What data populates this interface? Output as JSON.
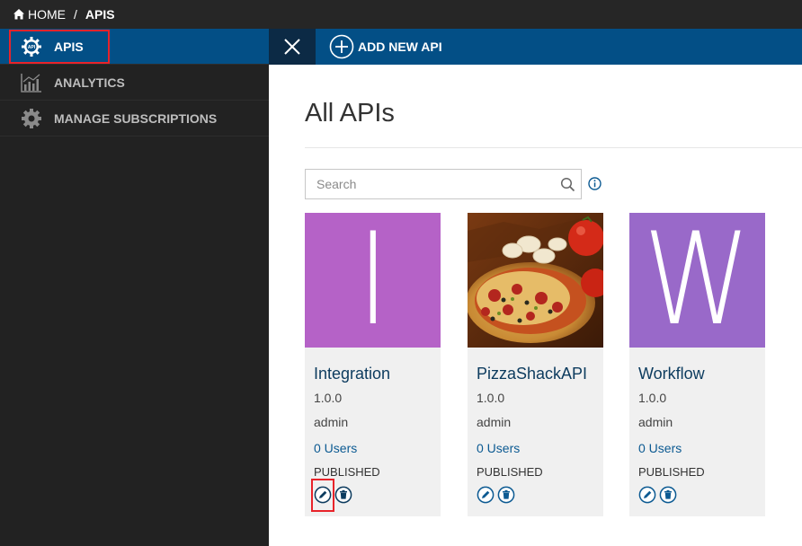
{
  "breadcrumb": {
    "home_label": "HOME",
    "separator": "/",
    "current": "APIS"
  },
  "sidebar": {
    "items": [
      {
        "label": "APIS",
        "icon": "api-gear-icon",
        "active": true
      },
      {
        "label": "ANALYTICS",
        "icon": "analytics-chart-icon",
        "active": false
      },
      {
        "label": "MANAGE SUBSCRIPTIONS",
        "icon": "gear-icon",
        "active": false
      }
    ]
  },
  "actionbar": {
    "add_label": "ADD NEW API"
  },
  "main": {
    "title": "All APIs",
    "search": {
      "placeholder": "Search",
      "value": ""
    }
  },
  "cards": [
    {
      "thumb_letter": "I",
      "thumb_color": "#b562c7",
      "name": "Integration",
      "version": "1.0.0",
      "owner": "admin",
      "users": "0 Users",
      "status": "PUBLISHED"
    },
    {
      "thumb_image": "pizza-photo",
      "name": "PizzaShackAPI",
      "version": "1.0.0",
      "owner": "admin",
      "users": "0 Users",
      "status": "PUBLISHED"
    },
    {
      "thumb_letter": "W",
      "thumb_color": "#9969c9",
      "name": "Workflow",
      "version": "1.0.0",
      "owner": "admin",
      "users": "0 Users",
      "status": "PUBLISHED"
    }
  ],
  "colors": {
    "accent": "#034f86",
    "highlight": "#e8232a",
    "sidebar_bg": "#222222",
    "topbar_bg": "#262626"
  }
}
